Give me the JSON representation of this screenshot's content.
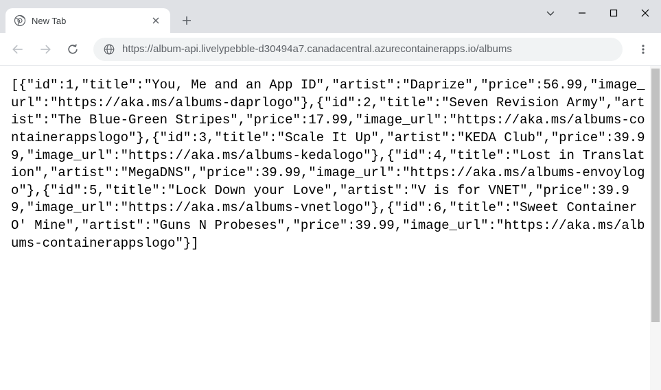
{
  "tab": {
    "title": "New Tab"
  },
  "omnibox": {
    "url_prefix": "https://album-api.livelypebble-d30494a7.canadacentral.azurecontainerapps.io/",
    "url_path": "albums"
  },
  "response_body": "[{\"id\":1,\"title\":\"You, Me and an App ID\",\"artist\":\"Daprize\",\"price\":56.99,\"image_url\":\"https://aka.ms/albums-daprlogo\"},{\"id\":2,\"title\":\"Seven Revision Army\",\"artist\":\"The Blue-Green Stripes\",\"price\":17.99,\"image_url\":\"https://aka.ms/albums-containerappslogo\"},{\"id\":3,\"title\":\"Scale It Up\",\"artist\":\"KEDA Club\",\"price\":39.99,\"image_url\":\"https://aka.ms/albums-kedalogo\"},{\"id\":4,\"title\":\"Lost in Translation\",\"artist\":\"MegaDNS\",\"price\":39.99,\"image_url\":\"https://aka.ms/albums-envoylogo\"},{\"id\":5,\"title\":\"Lock Down your Love\",\"artist\":\"V is for VNET\",\"price\":39.99,\"image_url\":\"https://aka.ms/albums-vnetlogo\"},{\"id\":6,\"title\":\"Sweet Container O' Mine\",\"artist\":\"Guns N Probeses\",\"price\":39.99,\"image_url\":\"https://aka.ms/albums-containerappslogo\"}]"
}
